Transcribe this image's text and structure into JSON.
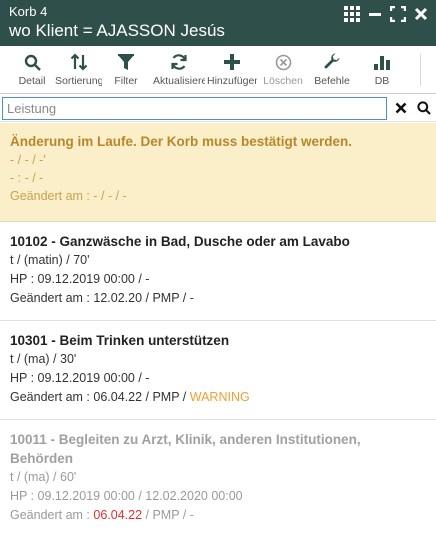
{
  "window": {
    "basket_label": "Korb 4",
    "title": "wo Klient = AJASSON Jesús"
  },
  "toolbar": {
    "buttons": [
      {
        "label": "Detail",
        "icon": "search-icon"
      },
      {
        "label": "Sortierung",
        "icon": "sort-icon"
      },
      {
        "label": "Filter",
        "icon": "filter-icon"
      },
      {
        "label": "Aktualisieren",
        "icon": "refresh-icon"
      },
      {
        "label": "Hinzufügen",
        "icon": "plus-icon"
      },
      {
        "label": "Löschen",
        "icon": "delete-icon",
        "disabled": true
      },
      {
        "label": "Befehle",
        "icon": "wrench-icon"
      },
      {
        "label": "DB",
        "icon": "bar-chart-icon"
      }
    ]
  },
  "search": {
    "placeholder": "Leistung",
    "value": ""
  },
  "notice": {
    "heading": "Änderung im Laufe. Der Korb muss bestätigt werden.",
    "line1": "- / - / -'",
    "line2": "- : - / -",
    "line3": "Geändert am : - / - / -"
  },
  "items": [
    {
      "title": "10102 - Ganzwäsche in Bad, Dusche oder am Lavabo",
      "line1": "t / (matin) / 70'",
      "line2": "HP : 09.12.2019 00:00 / -",
      "changed_prefix": "Geändert am : ",
      "changed_date": "12.02.20",
      "changed_suffix": " / PMP / -",
      "status": ""
    },
    {
      "title": "10301 - Beim Trinken unterstützen",
      "line1": "t / (ma) / 30'",
      "line2": "HP : 09.12.2019 00:00 / -",
      "changed_prefix": "Geändert am : ",
      "changed_date": "06.04.22",
      "changed_suffix": " / PMP / ",
      "status": "WARNING"
    },
    {
      "title": "10011 - Begleiten zu Arzt, Klinik, anderen Institutionen, Behörden",
      "line1": "t / (ma) / 60'",
      "line2": "HP : 09.12.2019 00:00 / 12.02.2020 00:00",
      "changed_prefix": "Geändert am : ",
      "changed_date": "06.04.22",
      "changed_suffix": " / PMP / -",
      "status": ""
    }
  ],
  "colors": {
    "titlebar": "#2f4f4b",
    "notice_bg": "#fbefc9",
    "notice_text": "#b8862b",
    "warning": "#f0a030",
    "expired_date": "#e03030"
  }
}
